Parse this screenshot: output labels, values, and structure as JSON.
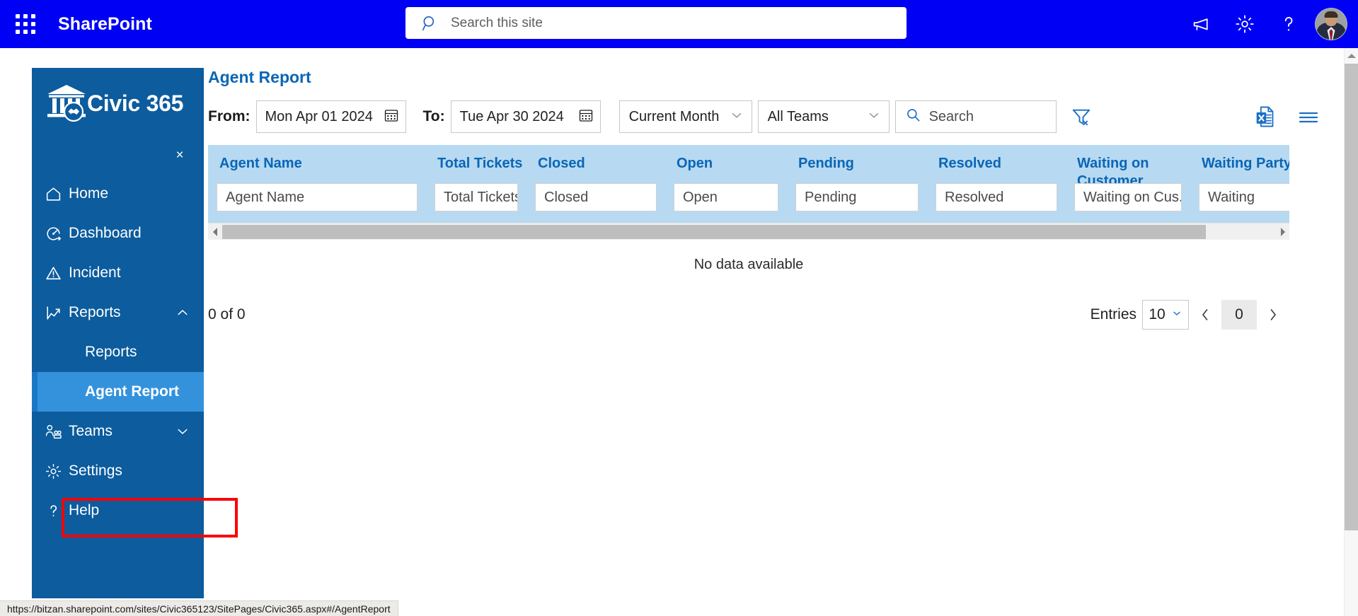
{
  "suite": {
    "waffle_icon": "app-launcher-icon",
    "title": "SharePoint",
    "search_placeholder": "Search this site",
    "search_value": "",
    "search_icon": "search-icon",
    "megaphone_icon": "megaphone-icon",
    "settings_icon": "gear-icon",
    "help_icon": "question-mark-icon",
    "avatar_icon": "user-avatar",
    "bar_color": "#0000f5"
  },
  "sidebar": {
    "brand": "Civic 365",
    "brand_logo_icon": "civic-building-handshake-logo",
    "close_label": "×",
    "bg_color": "#0c5c9e",
    "selected_color": "#3492dd",
    "highlight_box_color": "#fb0007",
    "items": [
      {
        "label": "Home",
        "icon": "home-icon",
        "chevron": "",
        "type": "item"
      },
      {
        "label": "Dashboard",
        "icon": "dashboard-gauge-icon",
        "chevron": "",
        "type": "item"
      },
      {
        "label": "Incident",
        "icon": "warning-triangle-icon",
        "chevron": "",
        "type": "item"
      },
      {
        "label": "Reports",
        "icon": "line-chart-icon",
        "chevron": "chevron-up-icon",
        "type": "item"
      },
      {
        "label": "Reports",
        "icon": "",
        "chevron": "",
        "type": "sub"
      },
      {
        "label": "Agent Report",
        "icon": "",
        "chevron": "",
        "type": "sub",
        "selected": true
      },
      {
        "label": "Teams",
        "icon": "people-icon",
        "chevron": "chevron-down-icon",
        "type": "item"
      },
      {
        "label": "Settings",
        "icon": "gear-icon",
        "chevron": "",
        "type": "item"
      },
      {
        "label": "Help",
        "icon": "question-mark-icon",
        "chevron": "",
        "type": "item"
      }
    ]
  },
  "main": {
    "title": "Agent Report",
    "title_color": "#0a66b5",
    "filters": {
      "from_label": "From:",
      "from_value": "Mon Apr 01 2024",
      "from_icon": "calendar-icon",
      "to_label": "To:",
      "to_value": "Tue Apr 30 2024",
      "to_icon": "calendar-icon",
      "period_value": "Current Month",
      "period_icon": "chevron-down-icon",
      "team_value": "All Teams",
      "team_icon": "chevron-down-icon",
      "search_placeholder": "Search",
      "search_value": "",
      "search_icon": "search-icon",
      "clear_filter_icon": "filter-clear-icon"
    },
    "tools": {
      "export_excel_icon": "excel-export-icon",
      "menu_icon": "hamburger-menu-icon"
    },
    "grid": {
      "header_bg": "#b7d9f2",
      "header_text_color": "#0a66b5",
      "columns": [
        {
          "header": "Agent Name",
          "filter_placeholder": "Agent Name"
        },
        {
          "header": "Total Tickets",
          "filter_placeholder": "Total Tickets"
        },
        {
          "header": "Closed",
          "filter_placeholder": "Closed"
        },
        {
          "header": "Open",
          "filter_placeholder": "Open"
        },
        {
          "header": "Pending",
          "filter_placeholder": "Pending"
        },
        {
          "header": "Resolved",
          "filter_placeholder": "Resolved"
        },
        {
          "header": "Waiting on Customer",
          "filter_placeholder": "Waiting on Cus..."
        },
        {
          "header": "Waiting Party",
          "filter_placeholder": "Waiting"
        }
      ],
      "rows": [],
      "empty_message": "No data available",
      "scroll_left_icon": "chevron-left-icon",
      "scroll_right_icon": "chevron-right-icon"
    },
    "footer": {
      "count_text": "0 of 0",
      "entries_label": "Entries",
      "entries_value": "10",
      "entries_icon": "chevron-down-icon",
      "prev_icon": "chevron-left-icon",
      "next_icon": "chevron-right-icon",
      "page_number": "0"
    }
  },
  "statusbar": {
    "url": "https://bitzan.sharepoint.com/sites/Civic365123/SitePages/Civic365.aspx#/AgentReport"
  }
}
